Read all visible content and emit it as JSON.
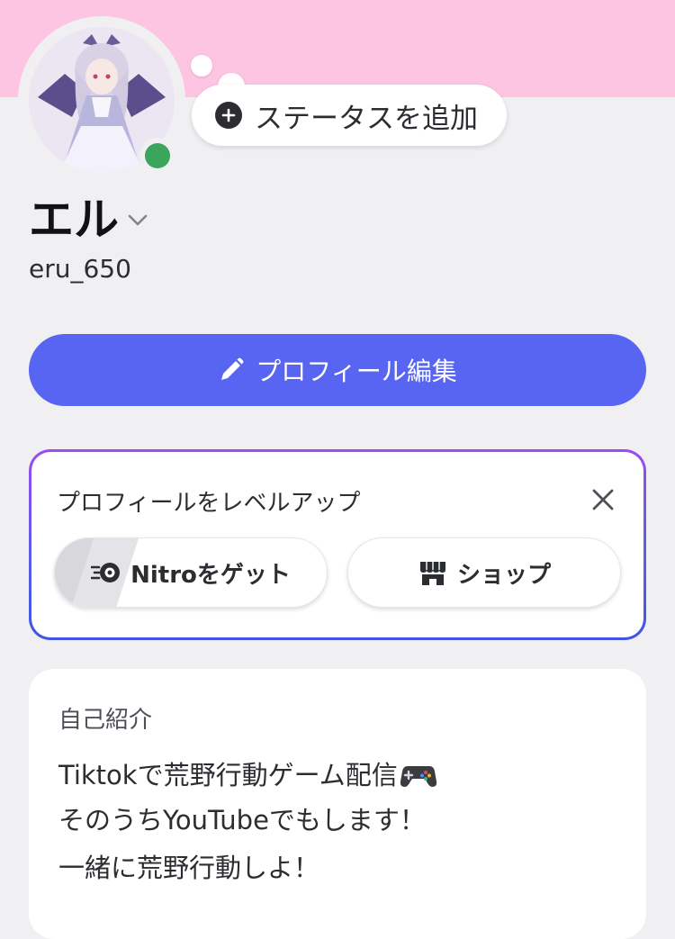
{
  "profile": {
    "display_name": "エル",
    "username": "eru_650",
    "status_prompt": "ステータスを追加",
    "presence": "online",
    "banner_color": "#fdc5e2",
    "presence_color": "#3ba55d"
  },
  "actions": {
    "edit_profile": "プロフィール編集",
    "edit_icon": "pencil-icon",
    "accent_color": "#5865f2"
  },
  "level_up": {
    "title": "プロフィールをレベルアップ",
    "nitro_label": "Nitroをゲット",
    "shop_label": "ショップ",
    "nitro_icon": "nitro-icon",
    "shop_icon": "shop-icon",
    "close_icon": "close-icon"
  },
  "about": {
    "title": "自己紹介",
    "lines": [
      "Tiktokで荒野行動ゲーム配信",
      "そのうちYouTubeでもします！",
      "一緒に荒野行動しよ！"
    ],
    "emoji_icon": "game-controller-icon"
  }
}
